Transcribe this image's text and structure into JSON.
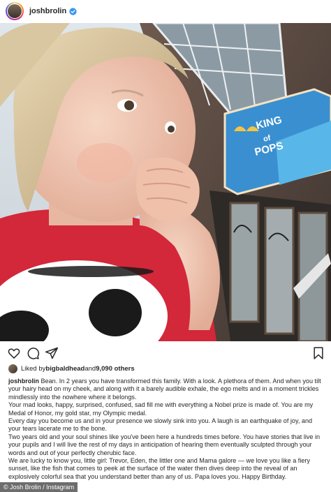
{
  "header": {
    "username": "joshbrolin",
    "verified_icon": "verified-badge-icon",
    "avatar_icon": "profile-avatar"
  },
  "photo": {
    "sign_text_line1": "KING",
    "sign_text_line2": "of",
    "sign_text_line3": "POPS"
  },
  "actions": {
    "like_icon": "heart-icon",
    "comment_icon": "comment-icon",
    "share_icon": "share-icon",
    "save_icon": "bookmark-icon"
  },
  "likes": {
    "prefix": "Liked by ",
    "liker": "bigbaldhead",
    "middle": " and ",
    "count": "9,090 others"
  },
  "caption": {
    "username": "joshbrolin",
    "paragraphs": [
      " Bean. In 2 years you have transformed this family. With a look. A plethora of them. And when you tilt your hairy head on my cheek, and along with it a barely audible exhale, the ego melts and in a moment trickles mindlessly into the nowhere where it belongs.",
      "Your mad looks, happy, surprised, confused, sad fill me with everything a Nobel prize is made of. You are my Medal of Honor, my gold star, my Olympic medal.",
      "Every day you become us and in your presence we slowly sink into you. A laugh is an earthquake of joy, and your tears lacerate me to the bone.",
      "Two years old and your soul shines like you've been here a hundreds times before. You have stories that live in your pupils and I will live the rest of my days in anticipation of hearing them eventually sculpted through your words and out of your perfectly cherubic face.",
      "We are lucky to know you, little girl: Trevor, Eden, the littler one and Mama galore — we love you like a fiery sunset, like the fish that comes to peek at the surface of the water then dives deep into the reveal of an explosively colorful sea that you understand better than any of us. Papa loves you. Happy Birthday."
    ]
  },
  "credit": "© Josh Brolin / Instagram",
  "colors": {
    "text": "#262626",
    "verified": "#3897f0",
    "shirt": "#d3273a"
  }
}
